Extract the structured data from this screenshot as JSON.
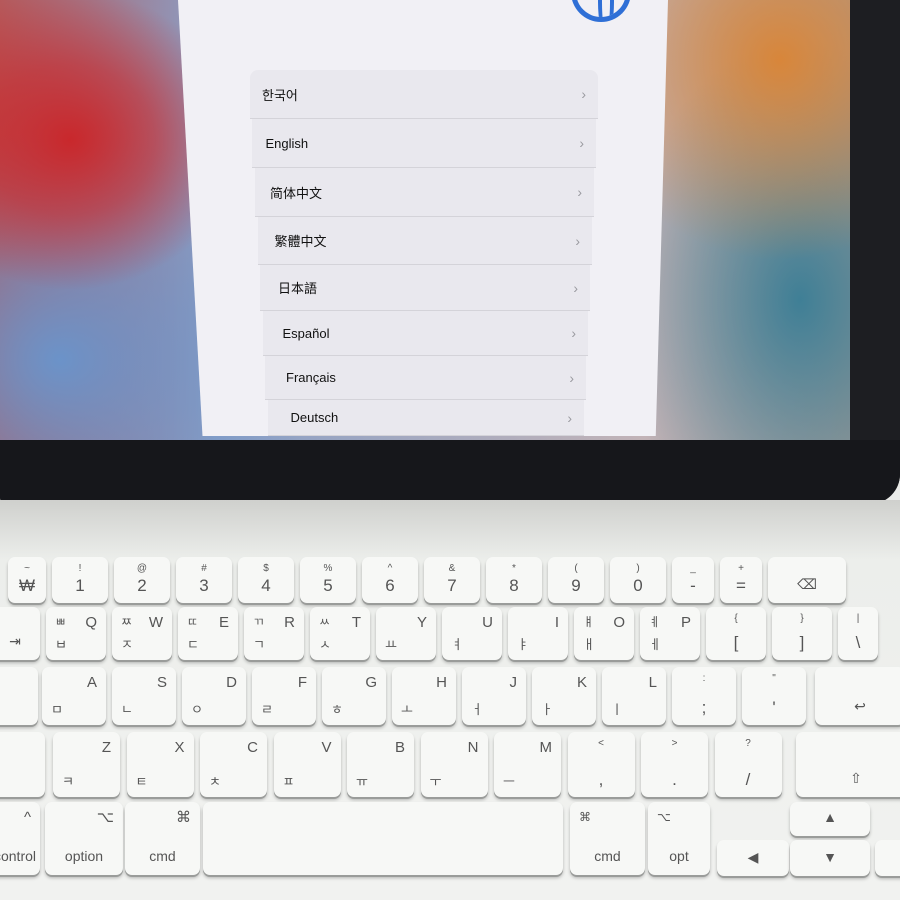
{
  "setup": {
    "globe_icon": "globe-icon",
    "accent": "#2f6fd6",
    "languages": [
      "한국어",
      "English",
      "简体中文",
      "繁體中文",
      "日本語",
      "Español",
      "Français",
      "Deutsch"
    ],
    "chevron": "›"
  },
  "keyboard": {
    "rows": [
      [
        {
          "t": "~",
          "b": "₩"
        },
        {
          "t": "!",
          "b": "1"
        },
        {
          "t": "@",
          "b": "2"
        },
        {
          "t": "#",
          "b": "3"
        },
        {
          "t": "$",
          "b": "4"
        },
        {
          "t": "%",
          "b": "5"
        },
        {
          "t": "^",
          "b": "6"
        },
        {
          "t": "&",
          "b": "7"
        },
        {
          "t": "*",
          "b": "8"
        },
        {
          "t": "(",
          "b": "9"
        },
        {
          "t": ")",
          "b": "0"
        },
        {
          "t": "_",
          "b": "-"
        },
        {
          "t": "+",
          "b": "="
        },
        {
          "lab": "⌫",
          "name": "delete"
        }
      ],
      [
        {
          "lab": "⇥",
          "name": "tab"
        },
        {
          "tl": "ㅃ",
          "tr": "Q",
          "bl": "ㅂ"
        },
        {
          "tl": "ㅉ",
          "tr": "W",
          "bl": "ㅈ"
        },
        {
          "tl": "ㄸ",
          "tr": "E",
          "bl": "ㄷ"
        },
        {
          "tl": "ㄲ",
          "tr": "R",
          "bl": "ㄱ"
        },
        {
          "tl": "ㅆ",
          "tr": "T",
          "bl": "ㅅ"
        },
        {
          "tr": "Y",
          "bl": "ㅛ"
        },
        {
          "tr": "U",
          "bl": "ㅕ"
        },
        {
          "tr": "I",
          "bl": "ㅑ"
        },
        {
          "tl": "ㅒ",
          "tr": "O",
          "bl": "ㅐ"
        },
        {
          "tl": "ㅖ",
          "tr": "P",
          "bl": "ㅔ"
        },
        {
          "t": "{",
          "b": "["
        },
        {
          "t": "}",
          "b": "]"
        },
        {
          "t": "|",
          "b": "\\"
        }
      ],
      [
        {
          "lab": "",
          "name": "caps-lock"
        },
        {
          "tr": "A",
          "bl": "ㅁ"
        },
        {
          "tr": "S",
          "bl": "ㄴ"
        },
        {
          "tr": "D",
          "bl": "ㅇ"
        },
        {
          "tr": "F",
          "bl": "ㄹ"
        },
        {
          "tr": "G",
          "bl": "ㅎ"
        },
        {
          "tr": "H",
          "bl": "ㅗ"
        },
        {
          "tr": "J",
          "bl": "ㅓ"
        },
        {
          "tr": "K",
          "bl": "ㅏ"
        },
        {
          "tr": "L",
          "bl": "ㅣ"
        },
        {
          "t": ":",
          "b": ";"
        },
        {
          "t": "\"",
          "b": "'"
        },
        {
          "lab": "↩",
          "name": "return"
        }
      ],
      [
        {
          "lab": "",
          "name": "shift-left"
        },
        {
          "tr": "Z",
          "bl": "ㅋ"
        },
        {
          "tr": "X",
          "bl": "ㅌ"
        },
        {
          "tr": "C",
          "bl": "ㅊ"
        },
        {
          "tr": "V",
          "bl": "ㅍ"
        },
        {
          "tr": "B",
          "bl": "ㅠ"
        },
        {
          "tr": "N",
          "bl": "ㅜ"
        },
        {
          "tr": "M",
          "bl": "ㅡ"
        },
        {
          "t": "<",
          "b": ","
        },
        {
          "t": ">",
          "b": "."
        },
        {
          "t": "?",
          "b": "/"
        },
        {
          "lab": "⇧",
          "name": "shift-right"
        }
      ],
      [
        {
          "tr": "^",
          "lab": "control",
          "name": "control"
        },
        {
          "tr": "⌥",
          "lab": "option",
          "name": "option"
        },
        {
          "tr": "⌘",
          "lab": "cmd",
          "name": "cmd-left"
        },
        {
          "lab": "",
          "name": "space"
        },
        {
          "tl": "⌘",
          "lab": "cmd",
          "name": "cmd-right"
        },
        {
          "tl": "⌥",
          "lab": "opt",
          "name": "opt"
        },
        {
          "lab": "◀",
          "name": "arrow-left"
        },
        {
          "lab": "▲",
          "name": "arrow-up"
        },
        {
          "lab": "▼",
          "name": "arrow-down"
        },
        {
          "lab": "",
          "name": "arrow-right"
        }
      ]
    ]
  }
}
